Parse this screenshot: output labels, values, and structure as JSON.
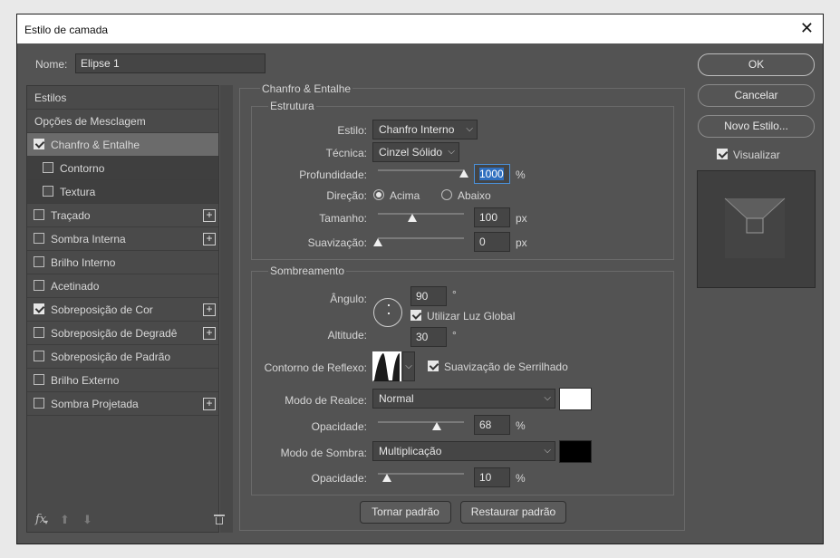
{
  "window": {
    "title": "Estilo de camada",
    "close_glyph": "✕"
  },
  "name": {
    "label": "Nome:",
    "value": "Elipse 1"
  },
  "styles_list": {
    "items": [
      {
        "label": "Estilos",
        "checkbox": false,
        "checked": false,
        "plus": false,
        "indent": false,
        "selected": false
      },
      {
        "label": "Opções de Mesclagem",
        "checkbox": false,
        "checked": false,
        "plus": false,
        "indent": false,
        "selected": false
      },
      {
        "label": "Chanfro & Entalhe",
        "checkbox": true,
        "checked": true,
        "plus": false,
        "indent": false,
        "selected": true
      },
      {
        "label": "Contorno",
        "checkbox": true,
        "checked": false,
        "plus": false,
        "indent": true,
        "selected": false
      },
      {
        "label": "Textura",
        "checkbox": true,
        "checked": false,
        "plus": false,
        "indent": true,
        "selected": false
      },
      {
        "label": "Traçado",
        "checkbox": true,
        "checked": false,
        "plus": true,
        "indent": false,
        "selected": false
      },
      {
        "label": "Sombra Interna",
        "checkbox": true,
        "checked": false,
        "plus": true,
        "indent": false,
        "selected": false
      },
      {
        "label": "Brilho Interno",
        "checkbox": true,
        "checked": false,
        "plus": false,
        "indent": false,
        "selected": false
      },
      {
        "label": "Acetinado",
        "checkbox": true,
        "checked": false,
        "plus": false,
        "indent": false,
        "selected": false
      },
      {
        "label": "Sobreposição de Cor",
        "checkbox": true,
        "checked": true,
        "plus": true,
        "indent": false,
        "selected": false
      },
      {
        "label": "Sobreposição de Degradê",
        "checkbox": true,
        "checked": false,
        "plus": true,
        "indent": false,
        "selected": false
      },
      {
        "label": "Sobreposição de Padrão",
        "checkbox": true,
        "checked": false,
        "plus": false,
        "indent": false,
        "selected": false
      },
      {
        "label": "Brilho Externo",
        "checkbox": true,
        "checked": false,
        "plus": false,
        "indent": false,
        "selected": false
      },
      {
        "label": "Sombra Projetada",
        "checkbox": true,
        "checked": false,
        "plus": true,
        "indent": false,
        "selected": false
      }
    ],
    "footer": {
      "fx_label": "fx",
      "up_icon": "arrow-up-icon",
      "down_icon": "arrow-down-icon",
      "trash_icon": "trash-icon"
    }
  },
  "bevel": {
    "title": "Chanfro & Entalhe",
    "structure": {
      "title": "Estrutura",
      "style_label": "Estilo:",
      "style_value": "Chanfro Interno",
      "technique_label": "Técnica:",
      "technique_value": "Cinzel Sólido",
      "depth_label": "Profundidade:",
      "depth_value": "1000",
      "depth_unit": "%",
      "depth_fraction": 1.0,
      "direction_label": "Direção:",
      "direction_up": "Acima",
      "direction_down": "Abaixo",
      "direction_selected": "up",
      "size_label": "Tamanho:",
      "size_value": "100",
      "size_unit": "px",
      "size_fraction": 0.4,
      "soften_label": "Suavização:",
      "soften_value": "0",
      "soften_unit": "px",
      "soften_fraction": 0.0
    },
    "shading": {
      "title": "Sombreamento",
      "angle_label": "Ângulo:",
      "angle_value": "90",
      "angle_unit": "°",
      "global_light_label": "Utilizar Luz Global",
      "global_light_checked": true,
      "altitude_label": "Altitude:",
      "altitude_value": "30",
      "altitude_unit": "°",
      "gloss_label": "Contorno de Reflexo:",
      "antialias_label": "Suavização de Serrilhado",
      "antialias_checked": true,
      "highlight_mode_label": "Modo de Realce:",
      "highlight_mode_value": "Normal",
      "highlight_color": "#ffffff",
      "highlight_opacity_label": "Opacidade:",
      "highlight_opacity_value": "68",
      "highlight_opacity_unit": "%",
      "highlight_opacity_fraction": 0.68,
      "shadow_mode_label": "Modo de Sombra:",
      "shadow_mode_value": "Multiplicação",
      "shadow_color": "#000000",
      "shadow_opacity_label": "Opacidade:",
      "shadow_opacity_value": "10",
      "shadow_opacity_unit": "%",
      "shadow_opacity_fraction": 0.1
    },
    "make_default": "Tornar padrão",
    "reset_default": "Restaurar padrão"
  },
  "actions": {
    "ok": "OK",
    "cancel": "Cancelar",
    "new_style": "Novo Estilo...",
    "preview_label": "Visualizar",
    "preview_checked": true
  }
}
